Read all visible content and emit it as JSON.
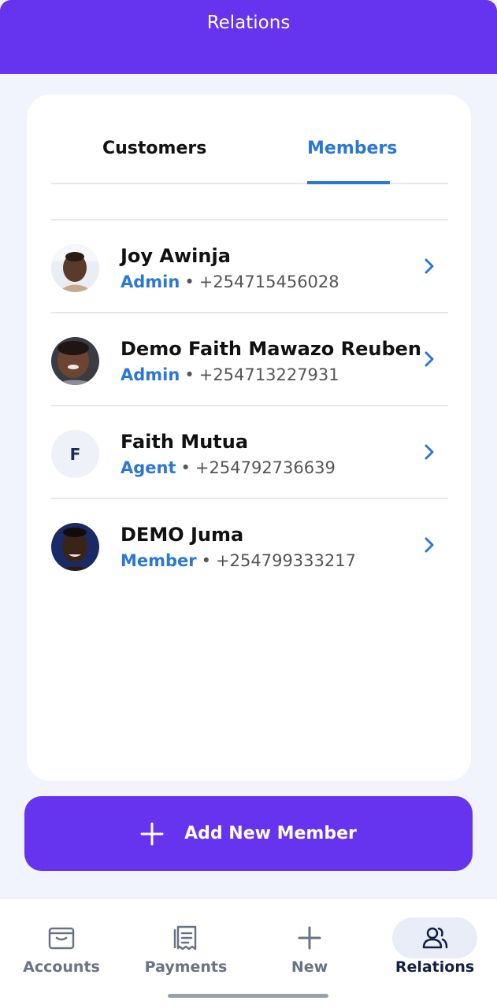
{
  "header": {
    "title": "Relations"
  },
  "tabs": [
    {
      "label": "Customers",
      "active": false
    },
    {
      "label": "Members",
      "active": true
    }
  ],
  "members": [
    {
      "name": "Joy Awinja",
      "role": "Admin",
      "separator": "•",
      "phone": "+254715456028",
      "avatar": "photo"
    },
    {
      "name": "Demo Faith Mawazo Reuben",
      "role": "Admin",
      "separator": "•",
      "phone": "+254713227931",
      "avatar": "photo"
    },
    {
      "name": "Faith Mutua",
      "role": "Agent",
      "separator": "•",
      "phone": "+254792736639",
      "avatar": "initial",
      "initial": "F"
    },
    {
      "name": "DEMO Juma",
      "role": "Member",
      "separator": "•",
      "phone": "+254799333217",
      "avatar": "photo"
    }
  ],
  "actions": {
    "add_member_label": "Add New Member"
  },
  "bottom_nav": [
    {
      "label": "Accounts",
      "icon": "wallet-icon",
      "active": false
    },
    {
      "label": "Payments",
      "icon": "receipt-icon",
      "active": false
    },
    {
      "label": "New",
      "icon": "plus-icon",
      "active": false
    },
    {
      "label": "Relations",
      "icon": "users-icon",
      "active": true
    }
  ],
  "colors": {
    "brand": "#6633ee",
    "accent": "#2a78d4",
    "background": "#f1f4fc",
    "nav_active": "#142043"
  }
}
